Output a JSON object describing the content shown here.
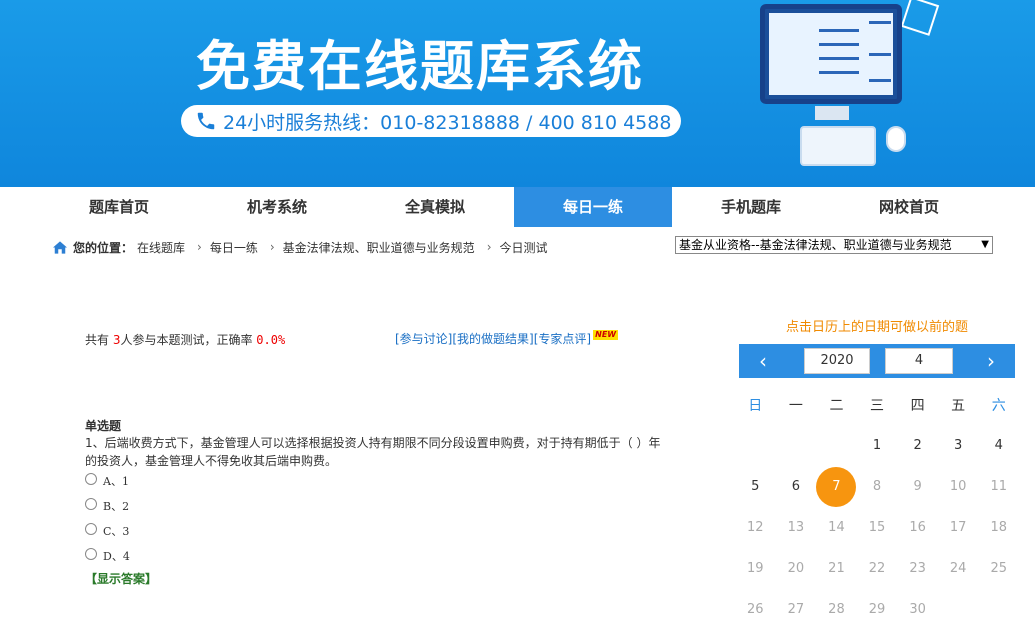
{
  "banner": {
    "title": "免费在线题库系统",
    "hotline": "24小时服务热线：010-82318888  /  400 810 4588"
  },
  "nav": {
    "items": [
      {
        "label": "题库首页"
      },
      {
        "label": "机考系统"
      },
      {
        "label": "全真模拟"
      },
      {
        "label": "每日一练"
      },
      {
        "label": "手机题库"
      },
      {
        "label": "网校首页"
      }
    ],
    "active_index": 3
  },
  "breadcrumb": {
    "label": "您的位置：",
    "items": [
      "在线题库",
      "每日一练",
      "基金法律法规、职业道德与业务规范",
      "今日测试"
    ]
  },
  "subject_select": {
    "value": "基金从业资格--基金法律法规、职业道德与业务规范"
  },
  "stats": {
    "prefix": "共有 ",
    "count": "3",
    "middle": "人参与本题测试，正确率 ",
    "rate": "0.0%"
  },
  "links": {
    "discuss": "[参与讨论]",
    "my_results": "[我的做题结果]",
    "expert": "[专家点评]",
    "new_badge": "NEW"
  },
  "question": {
    "type": "单选题",
    "text": "1、后端收费方式下，基金管理人可以选择根据投资人持有期限不同分段设置申购费，对于持有期低于（    ）年的投资人，基金管理人不得免收其后端申购费。",
    "options": [
      "A、1",
      "B、2",
      "C、3",
      "D、4"
    ],
    "show_answer": "【显示答案】"
  },
  "calendar": {
    "tip": "点击日历上的日期可做以前的题",
    "year": "2020",
    "month": "4",
    "prev": "‹",
    "next": "›",
    "weekdays": [
      "日",
      "一",
      "二",
      "三",
      "四",
      "五",
      "六"
    ],
    "weeks": [
      [
        "",
        "",
        "",
        "1",
        "2",
        "3",
        "4"
      ],
      [
        "5",
        "6",
        "7",
        "8",
        "9",
        "10",
        "11"
      ],
      [
        "12",
        "13",
        "14",
        "15",
        "16",
        "17",
        "18"
      ],
      [
        "19",
        "20",
        "21",
        "22",
        "23",
        "24",
        "25"
      ],
      [
        "26",
        "27",
        "28",
        "29",
        "30",
        "",
        ""
      ]
    ],
    "today": "7"
  },
  "colors": {
    "brand_blue": "#2d8ee2",
    "today_orange": "#f7950f",
    "tip_orange": "#f08a00"
  }
}
